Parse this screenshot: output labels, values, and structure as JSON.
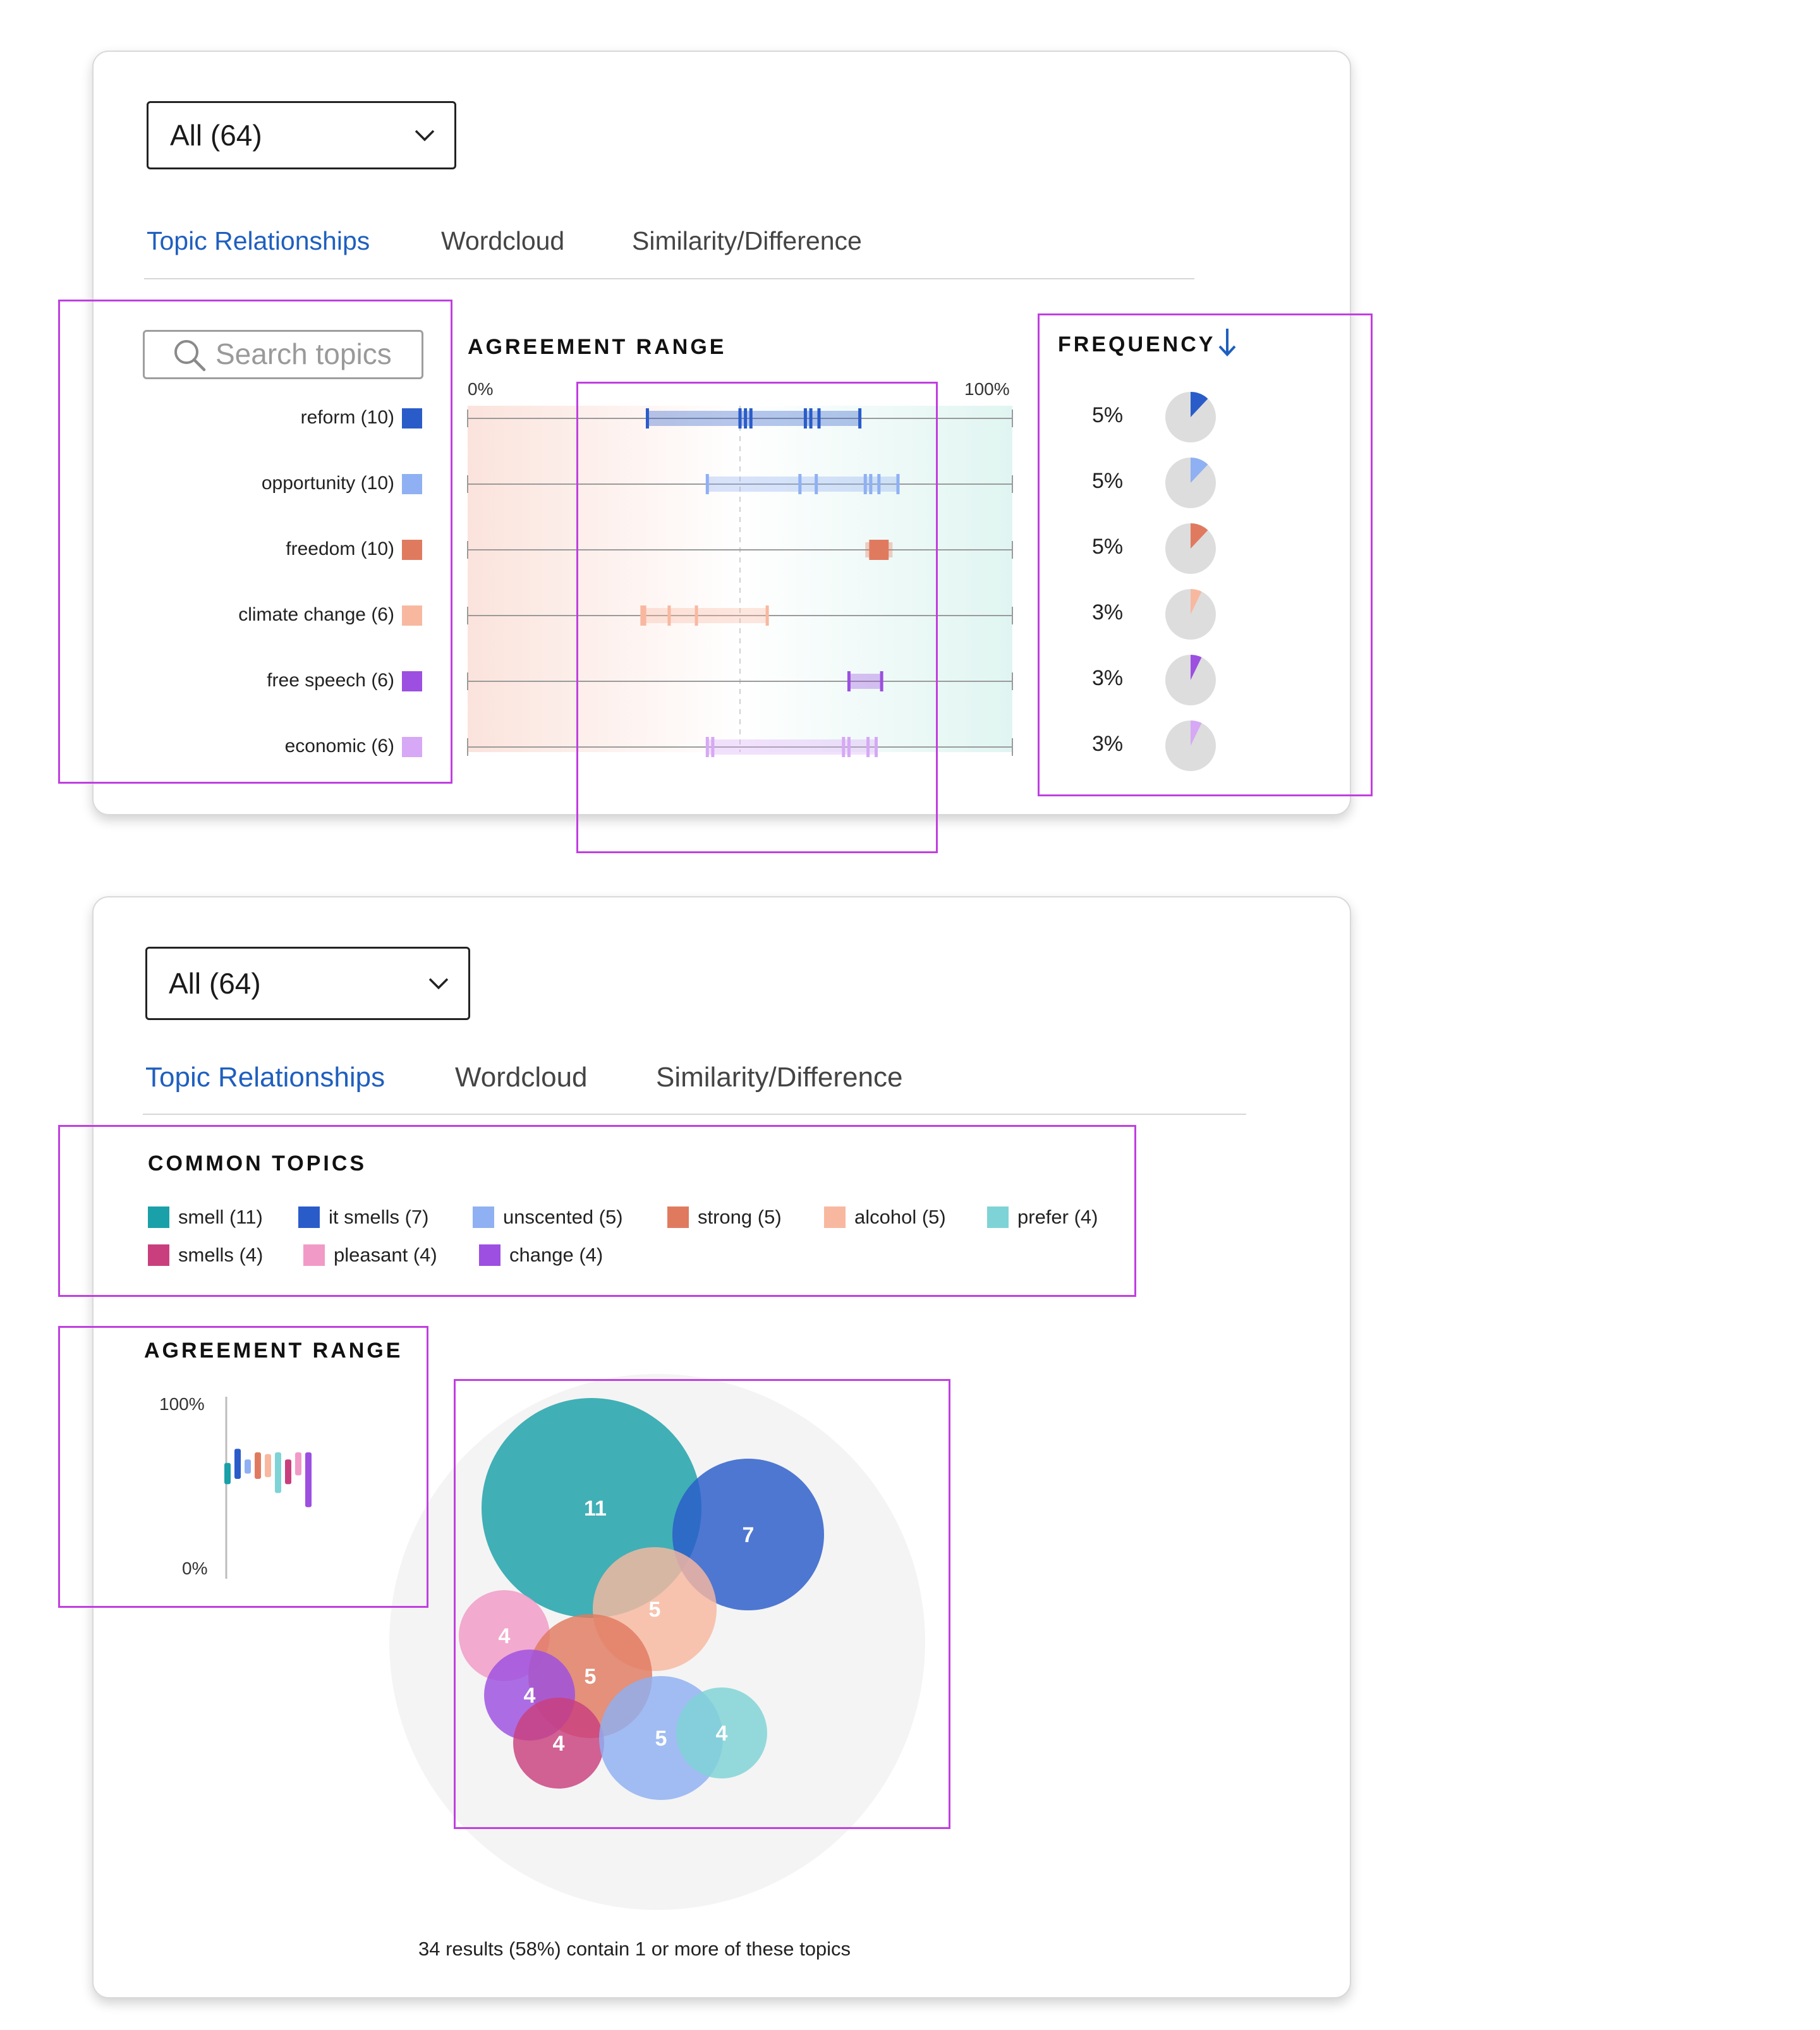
{
  "colors": {
    "accent": "#1f5fbf",
    "highlight": "#c03fe0",
    "border": "#d9d9d9"
  },
  "panel1": {
    "filter": {
      "value": "All (64)",
      "icon": "chevron-down-icon"
    },
    "tabs": [
      {
        "label": "Topic Relationships",
        "active": true
      },
      {
        "label": "Wordcloud",
        "active": false
      },
      {
        "label": "Similarity/Difference",
        "active": false
      }
    ],
    "search": {
      "placeholder": "Search topics",
      "icon": "search-icon"
    },
    "agreement_heading": "AGREEMENT RANGE",
    "axis": {
      "min_label": "0%",
      "max_label": "100%"
    },
    "frequency_heading": "FREQUENCY",
    "frequency_sort_icon": "arrow-down-icon",
    "topics": [
      {
        "label": "reform (10)",
        "color": "#2a5cc9",
        "range": [
          0.33,
          0.72
        ],
        "ticks": [
          0.33,
          0.5,
          0.51,
          0.52,
          0.62,
          0.63,
          0.645,
          0.72
        ],
        "frequency": "5%",
        "fraction": 0.05
      },
      {
        "label": "opportunity (10)",
        "color": "#8fb0f2",
        "range": [
          0.44,
          0.79
        ],
        "ticks": [
          0.44,
          0.61,
          0.64,
          0.73,
          0.74,
          0.755,
          0.79
        ],
        "frequency": "5%",
        "fraction": 0.05
      },
      {
        "label": "freedom (10)",
        "color": "#e07a5f",
        "range": [
          0.73,
          0.78
        ],
        "ticks": [
          0.74,
          0.745,
          0.75,
          0.755,
          0.76,
          0.765,
          0.77
        ],
        "frequency": "5%",
        "fraction": 0.05
      },
      {
        "label": "climate change (6)",
        "color": "#f8b8a0",
        "range": [
          0.32,
          0.55
        ],
        "ticks": [
          0.32,
          0.325,
          0.37,
          0.42,
          0.55
        ],
        "frequency": "3%",
        "fraction": 0.03
      },
      {
        "label": "free speech (6)",
        "color": "#9c4fe0",
        "range": [
          0.7,
          0.76
        ],
        "ticks": [
          0.7,
          0.76
        ],
        "frequency": "3%",
        "fraction": 0.03
      },
      {
        "label": "economic (6)",
        "color": "#d6a8f5",
        "range": [
          0.44,
          0.75
        ],
        "ticks": [
          0.44,
          0.45,
          0.69,
          0.7,
          0.735,
          0.75
        ],
        "frequency": "3%",
        "fraction": 0.03
      }
    ]
  },
  "panel2": {
    "filter": {
      "value": "All (64)",
      "icon": "chevron-down-icon"
    },
    "tabs": [
      {
        "label": "Topic Relationships",
        "active": true
      },
      {
        "label": "Wordcloud",
        "active": false
      },
      {
        "label": "Similarity/Difference",
        "active": false
      }
    ],
    "common_topics_heading": "COMMON TOPICS",
    "common_topics": [
      {
        "label": "smell (11)",
        "color": "#1aa0a8"
      },
      {
        "label": "it smells (7)",
        "color": "#2a5cc9"
      },
      {
        "label": "unscented (5)",
        "color": "#8fb0f2"
      },
      {
        "label": "strong (5)",
        "color": "#e07a5f"
      },
      {
        "label": "alcohol (5)",
        "color": "#f8b8a0"
      },
      {
        "label": "prefer (4)",
        "color": "#7ed3d6"
      },
      {
        "label": "smells (4)",
        "color": "#c93f7e"
      },
      {
        "label": "pleasant (4)",
        "color": "#f29ac7"
      },
      {
        "label": "change (4)",
        "color": "#9c4fe0"
      }
    ],
    "agreement_heading": "AGREEMENT RANGE",
    "mini_axis": {
      "max_label": "100%",
      "min_label": "0%"
    },
    "mini_bars": [
      {
        "color": "#1aa0a8",
        "range": [
          0.52,
          0.64
        ]
      },
      {
        "color": "#2a5cc9",
        "range": [
          0.55,
          0.72
        ]
      },
      {
        "color": "#8fb0f2",
        "range": [
          0.58,
          0.66
        ]
      },
      {
        "color": "#e07a5f",
        "range": [
          0.55,
          0.7
        ]
      },
      {
        "color": "#f8b8a0",
        "range": [
          0.56,
          0.69
        ]
      },
      {
        "color": "#7ed3d6",
        "range": [
          0.47,
          0.7
        ]
      },
      {
        "color": "#c93f7e",
        "range": [
          0.52,
          0.66
        ]
      },
      {
        "color": "#f29ac7",
        "range": [
          0.57,
          0.7
        ]
      },
      {
        "color": "#9c4fe0",
        "range": [
          0.39,
          0.7
        ]
      }
    ],
    "bubbles": [
      {
        "label": "11",
        "color": "#1aa0a8"
      },
      {
        "label": "7",
        "color": "#2a5cc9"
      },
      {
        "label": "5",
        "color": "#f8b8a0"
      },
      {
        "label": "4",
        "color": "#f29ac7"
      },
      {
        "label": "5",
        "color": "#e07a5f"
      },
      {
        "label": "4",
        "color": "#9c4fe0"
      },
      {
        "label": "4",
        "color": "#c93f7e"
      },
      {
        "label": "5",
        "color": "#8fb0f2"
      },
      {
        "label": "4",
        "color": "#7ed3d6"
      }
    ],
    "footer": "34 results (58%) contain 1 or more of these topics"
  }
}
